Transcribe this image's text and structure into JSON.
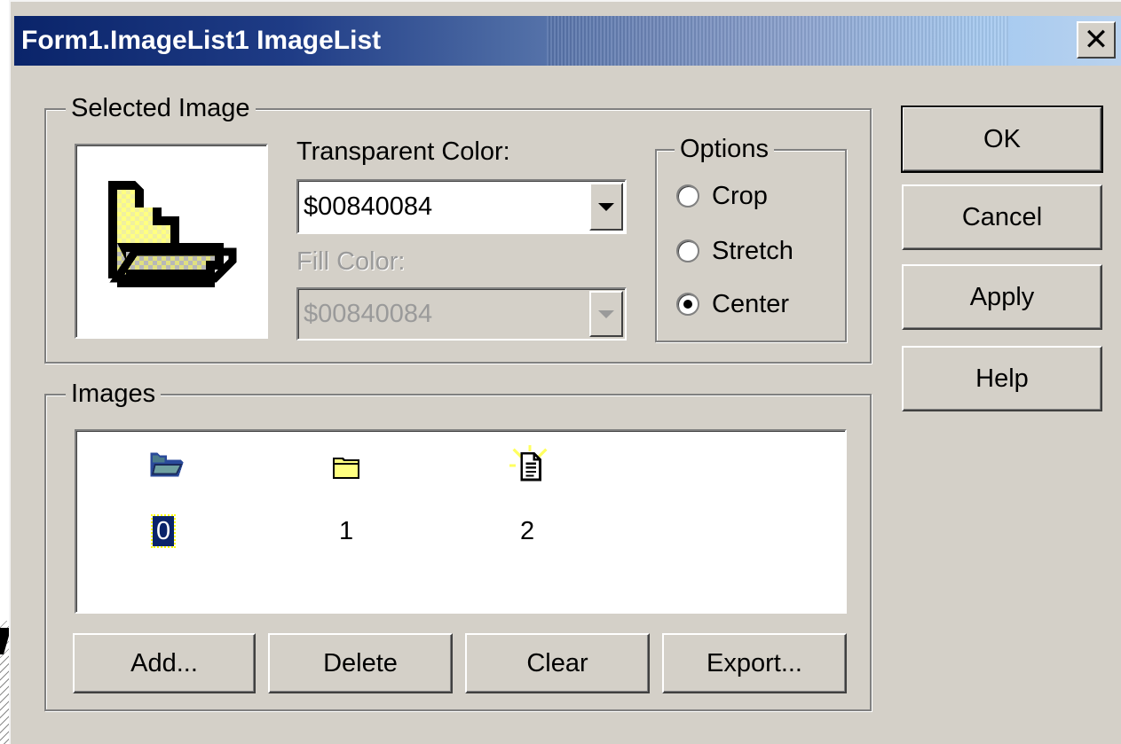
{
  "window": {
    "title": "Form1.ImageList1 ImageList",
    "close_glyph": "✕"
  },
  "selected_image_group": {
    "label": "Selected Image",
    "preview_icon": "open-folder-icon",
    "transparent_color": {
      "label": "Transparent Color:",
      "value": "$00840084"
    },
    "fill_color": {
      "label": "Fill Color:",
      "value": "$00840084",
      "disabled": true
    },
    "options": {
      "label": "Options",
      "items": [
        {
          "label": "Crop",
          "checked": false
        },
        {
          "label": "Stretch",
          "checked": false
        },
        {
          "label": "Center",
          "checked": true
        }
      ]
    }
  },
  "images_group": {
    "label": "Images",
    "items": [
      {
        "icon": "open-folder-icon",
        "index": "0",
        "selected": true
      },
      {
        "icon": "closed-folder-icon",
        "index": "1",
        "selected": false
      },
      {
        "icon": "new-document-icon",
        "index": "2",
        "selected": false
      }
    ],
    "buttons": {
      "add": "Add...",
      "delete": "Delete",
      "clear": "Clear",
      "export": "Export..."
    }
  },
  "side_buttons": {
    "ok": "OK",
    "cancel": "Cancel",
    "apply": "Apply",
    "help": "Help"
  },
  "colors": {
    "title_bar_start": "#0a246a",
    "title_bar_end": "#a6caf0",
    "dialog_face": "#d4d0c8",
    "folder_yellow": "#ffff80"
  }
}
